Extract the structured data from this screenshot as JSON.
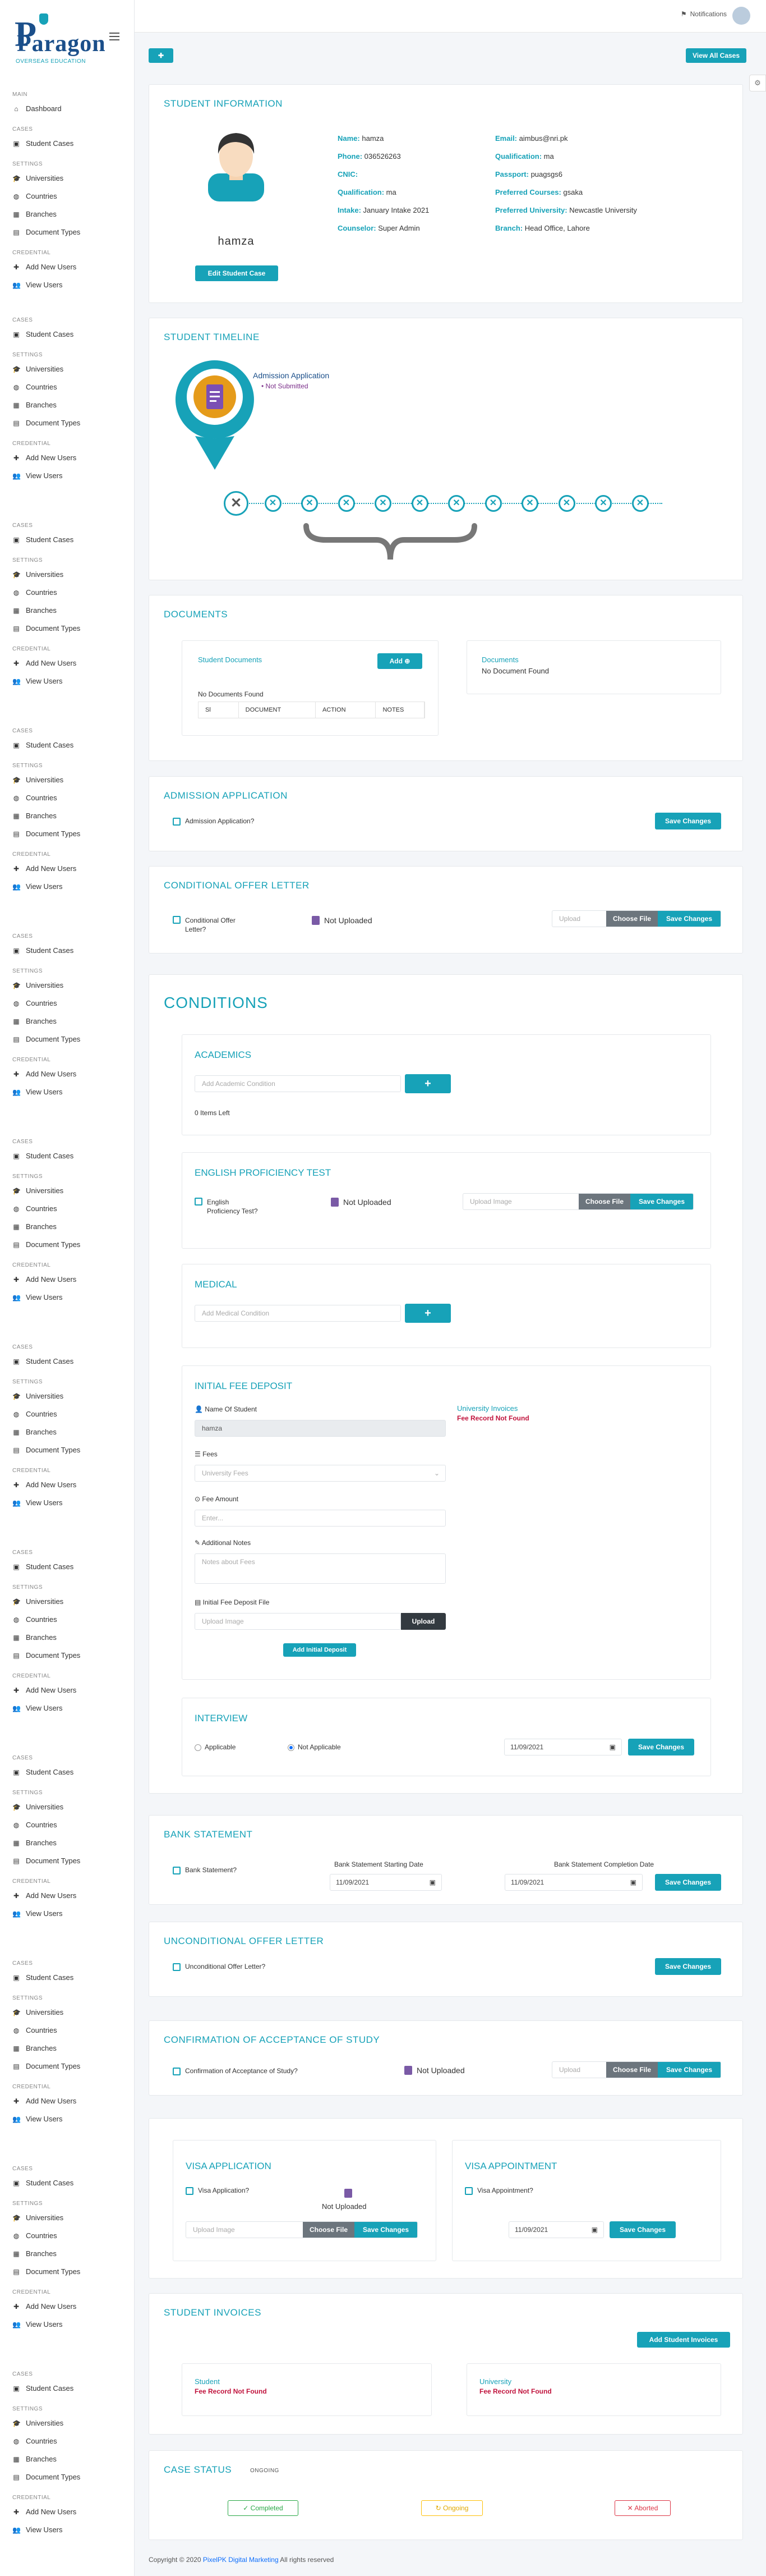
{
  "brand": {
    "name": "Paragon",
    "tagline": "OVERSEAS EDUCATION"
  },
  "header": {
    "notifications": "Notifications",
    "view_all_cases": "View All Cases",
    "add_icon": "plus-circle-icon"
  },
  "sidebar_groups": [
    {
      "main_label": "MAIN",
      "main_item": "Dashboard",
      "cases_label": "CASES",
      "cases_item": "Student Cases",
      "settings_label": "SETTINGS",
      "settings_items": [
        "Universities",
        "Countries",
        "Branches",
        "Document Types"
      ],
      "credential_label": "CREDENTIAL",
      "credential_items": [
        "Add New Users",
        "View Users"
      ]
    },
    {
      "cases_label": "CASES",
      "cases_item": "Student Cases",
      "settings_label": "SETTINGS",
      "settings_items": [
        "Universities",
        "Countries",
        "Branches",
        "Document Types"
      ],
      "credential_label": "CREDENTIAL",
      "credential_items": [
        "Add New Users",
        "View Users"
      ]
    }
  ],
  "student_info": {
    "title": "STUDENT INFORMATION",
    "name": "hamza",
    "edit_button": "Edit Student Case",
    "left": [
      {
        "k": "Name:",
        "v": " hamza"
      },
      {
        "k": "Phone:",
        "v": " 036526263"
      },
      {
        "k": "CNIC:",
        "v": ""
      },
      {
        "k": "Qualification:",
        "v": " ma"
      },
      {
        "k": "Intake:",
        "v": " January Intake 2021"
      },
      {
        "k": "Counselor:",
        "v": " Super Admin"
      }
    ],
    "right": [
      {
        "k": "Email:",
        "v": " aimbus@nri.pk"
      },
      {
        "k": "Qualification:",
        "v": " ma"
      },
      {
        "k": "Passport:",
        "v": " puagsgs6"
      },
      {
        "k": "Preferred Courses:",
        "v": " gsaka"
      },
      {
        "k": "Preferred University:",
        "v": " Newcastle University"
      },
      {
        "k": "Branch:",
        "v": " Head Office, Lahore"
      }
    ]
  },
  "timeline": {
    "title": "STUDENT TIMELINE",
    "stage": "Admission Application",
    "stage_status": "Not Submitted",
    "nodes": 12
  },
  "documents": {
    "title": "DOCUMENTS",
    "student_documents": "Student Documents",
    "add": "Add",
    "no_docs": "No Documents Found",
    "columns": [
      "Sl",
      "DOCUMENT",
      "ACTION",
      "NOTES"
    ],
    "right_title": "Documents",
    "right_text": "No Document Found"
  },
  "admission": {
    "title": "ADMISSION APPLICATION",
    "check": "Admission Application?",
    "save": "Save Changes"
  },
  "conditional": {
    "title": "CONDITIONAL OFFER LETTER",
    "check_line1": "Conditional Offer",
    "check_line2": "Letter?",
    "status": "Not Uploaded",
    "upload_ph": "Upload",
    "choose": "Choose File",
    "save": "Save Changes"
  },
  "conditions": {
    "title": "CONDITIONS",
    "academics": {
      "title": "ACADEMICS",
      "placeholder": "Add Academic Condition",
      "items_left": "0 Items Left"
    },
    "english": {
      "title": "ENGLISH PROFICIENCY TEST",
      "check_line1": "English",
      "check_line2": "Proficiency Test?",
      "status": "Not Uploaded",
      "upload_ph": "Upload Image",
      "choose": "Choose File",
      "save": "Save Changes"
    },
    "medical": {
      "title": "MEDICAL",
      "placeholder": "Add Medical Condition"
    },
    "fee": {
      "title": "INITIAL FEE DEPOSIT",
      "name_label": "Name Of Student",
      "name_value": "hamza",
      "fees_label": "Fees",
      "fees_ph": "University Fees",
      "amount_label": "Fee Amount",
      "amount_ph": "Enter...",
      "notes_label": "Additional Notes",
      "notes_ph": "Notes about Fees",
      "file_label": "Initial Fee Deposit File",
      "file_ph": "Upload Image",
      "upload": "Upload",
      "submit": "Add Initial Deposit",
      "invoices_title": "University Invoices",
      "invoices_text": "Fee Record Not Found"
    },
    "interview": {
      "title": "INTERVIEW",
      "opt1": "Applicable",
      "opt2": "Not Applicable",
      "date": "11/09/2021",
      "save": "Save Changes"
    }
  },
  "bank": {
    "title": "BANK STATEMENT",
    "check": "Bank Statement?",
    "start_label": "Bank Statement Starting Date",
    "end_label": "Bank Statement Completion Date",
    "start": "11/09/2021",
    "end": "11/09/2021",
    "save": "Save Changes"
  },
  "unconditional": {
    "title": "UNCONDITIONAL OFFER LETTER",
    "check": "Unconditional Offer Letter?",
    "save": "Save Changes"
  },
  "cas": {
    "title": "CONFIRMATION OF ACCEPTANCE OF STUDY",
    "check": "Confirmation of Acceptance of Study?",
    "status": "Not Uploaded",
    "upload_ph": "Upload",
    "choose": "Choose File",
    "save": "Save Changes"
  },
  "visa": {
    "title": "VISA APPLICATION",
    "check": "Visa Application?",
    "status": "Not Uploaded",
    "upload_ph": "Upload Image",
    "choose": "Choose File",
    "save": "Save Changes"
  },
  "visa_appt": {
    "title": "VISA APPOINTMENT",
    "check": "Visa Appointment?",
    "date": "11/09/2021",
    "save": "Save Changes"
  },
  "invoices": {
    "title": "STUDENT INVOICES",
    "add": "Add Student Invoices",
    "left_title": "Student",
    "left_text": "Fee Record Not Found",
    "right_title": "University",
    "right_text": "Fee Record Not Found"
  },
  "case_status": {
    "title": "CASE STATUS",
    "current": "ONGOING",
    "completed": "Completed",
    "ongoing": "Ongoing",
    "aborted": "Aborted"
  },
  "footer": {
    "text": "Copyright © 2020 ",
    "link": "PixelPK Digital Marketing",
    "suffix": " All rights reserved"
  }
}
